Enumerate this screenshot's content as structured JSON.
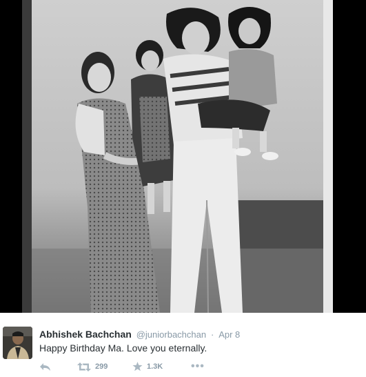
{
  "tweet": {
    "display_name": "Abhishek Bachchan",
    "handle": "@juniorbachchan",
    "separator": "·",
    "timestamp": "Apr 8",
    "text": "Happy Birthday Ma. Love you eternally."
  },
  "actions": {
    "reply_icon": "reply-icon",
    "retweet_icon": "retweet-icon",
    "retweet_count": "299",
    "favorite_icon": "star-icon",
    "favorite_count": "1.3K",
    "more_icon": "more-dots-icon",
    "more_label": "•••"
  },
  "media": {
    "description_icon": "family-photo",
    "style": "black-and-white"
  },
  "colors": {
    "name": "#292f33",
    "meta": "#8899a6",
    "action_icon": "#aab8c2"
  }
}
